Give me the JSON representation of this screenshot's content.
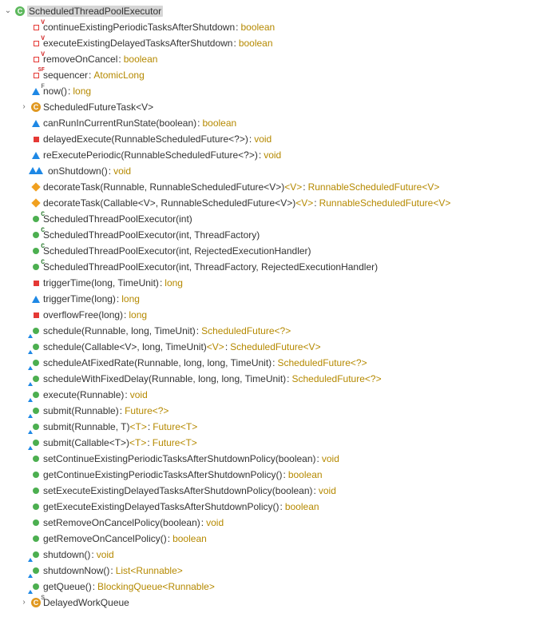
{
  "root": {
    "twisty": "open",
    "iconOverlays": [
      "VolatileRed"
    ],
    "name": "ScheduledThreadPoolExecutor",
    "selected": true
  },
  "members": [
    {
      "twisty": "none",
      "icon": "field-private",
      "ov1": {
        "txt": "V",
        "cls": "red"
      },
      "name": "continueExistingPeriodicTasksAfterShutdown",
      "ret": "boolean"
    },
    {
      "twisty": "none",
      "icon": "field-private",
      "ov1": {
        "txt": "V",
        "cls": "red"
      },
      "name": "executeExistingDelayedTasksAfterShutdown",
      "ret": "boolean"
    },
    {
      "twisty": "none",
      "icon": "field-private",
      "ov1": {
        "txt": "V",
        "cls": "red"
      },
      "name": "removeOnCancel",
      "ret": "boolean"
    },
    {
      "twisty": "none",
      "icon": "field-private",
      "ov1": {
        "txt": "SF",
        "cls": "red",
        "small": true
      },
      "name": "sequencer",
      "ret": "AtomicLong"
    },
    {
      "twisty": "none",
      "icon": "default",
      "ov1": {
        "txt": "F",
        "cls": "grey"
      },
      "name": "now()",
      "ret": "long"
    },
    {
      "twisty": "closed",
      "icon": "class-private",
      "name": "ScheduledFutureTask<V>"
    },
    {
      "twisty": "none",
      "icon": "default",
      "name": "canRunInCurrentRunState(boolean)",
      "ret": "boolean"
    },
    {
      "twisty": "none",
      "icon": "method-private",
      "name": "delayedExecute(RunnableScheduledFuture<?>)",
      "ret": "void"
    },
    {
      "twisty": "none",
      "icon": "default",
      "name": "reExecutePeriodic(RunnableScheduledFuture<?>)",
      "ret": "void"
    },
    {
      "twisty": "none",
      "icon": "dual-default",
      "name": "onShutdown()",
      "ret": "void"
    },
    {
      "twisty": "none",
      "icon": "protected",
      "name": "decorateTask(Runnable, RunnableScheduledFuture<V>)",
      "generic": "<V>",
      "ret": "RunnableScheduledFuture<V>"
    },
    {
      "twisty": "none",
      "icon": "protected",
      "name": "decorateTask(Callable<V>, RunnableScheduledFuture<V>)",
      "generic": "<V>",
      "ret": "RunnableScheduledFuture<V>"
    },
    {
      "twisty": "none",
      "icon": "method-public",
      "ov1": {
        "txt": "C",
        "cls": "green"
      },
      "name": "ScheduledThreadPoolExecutor(int)"
    },
    {
      "twisty": "none",
      "icon": "method-public",
      "ov1": {
        "txt": "C",
        "cls": "green"
      },
      "name": "ScheduledThreadPoolExecutor(int, ThreadFactory)"
    },
    {
      "twisty": "none",
      "icon": "method-public",
      "ov1": {
        "txt": "C",
        "cls": "green"
      },
      "name": "ScheduledThreadPoolExecutor(int, RejectedExecutionHandler)"
    },
    {
      "twisty": "none",
      "icon": "method-public",
      "ov1": {
        "txt": "C",
        "cls": "green"
      },
      "name": "ScheduledThreadPoolExecutor(int, ThreadFactory, RejectedExecutionHandler)"
    },
    {
      "twisty": "none",
      "icon": "method-private",
      "name": "triggerTime(long, TimeUnit)",
      "ret": "long"
    },
    {
      "twisty": "none",
      "icon": "default",
      "name": "triggerTime(long)",
      "ret": "long"
    },
    {
      "twisty": "none",
      "icon": "method-private",
      "name": "overflowFree(long)",
      "ret": "long"
    },
    {
      "twisty": "none",
      "icon": "method-public",
      "ovTri": true,
      "name": "schedule(Runnable, long, TimeUnit)",
      "ret": "ScheduledFuture<?>"
    },
    {
      "twisty": "none",
      "icon": "method-public",
      "ovTri": true,
      "name": "schedule(Callable<V>, long, TimeUnit)",
      "generic": "<V>",
      "ret": "ScheduledFuture<V>"
    },
    {
      "twisty": "none",
      "icon": "method-public",
      "ovTri": true,
      "name": "scheduleAtFixedRate(Runnable, long, long, TimeUnit)",
      "ret": "ScheduledFuture<?>"
    },
    {
      "twisty": "none",
      "icon": "method-public",
      "ovTri": true,
      "name": "scheduleWithFixedDelay(Runnable, long, long, TimeUnit)",
      "ret": "ScheduledFuture<?>"
    },
    {
      "twisty": "none",
      "icon": "method-public",
      "ovTri": true,
      "name": "execute(Runnable)",
      "ret": "void"
    },
    {
      "twisty": "none",
      "icon": "method-public",
      "ovTri": true,
      "name": "submit(Runnable)",
      "ret": "Future<?>"
    },
    {
      "twisty": "none",
      "icon": "method-public",
      "ovTri": true,
      "name": "submit(Runnable, T)",
      "generic": "<T>",
      "ret": "Future<T>"
    },
    {
      "twisty": "none",
      "icon": "method-public",
      "ovTri": true,
      "name": "submit(Callable<T>)",
      "generic": "<T>",
      "ret": "Future<T>"
    },
    {
      "twisty": "none",
      "icon": "method-public",
      "name": "setContinueExistingPeriodicTasksAfterShutdownPolicy(boolean)",
      "ret": "void"
    },
    {
      "twisty": "none",
      "icon": "method-public",
      "name": "getContinueExistingPeriodicTasksAfterShutdownPolicy()",
      "ret": "boolean"
    },
    {
      "twisty": "none",
      "icon": "method-public",
      "name": "setExecuteExistingDelayedTasksAfterShutdownPolicy(boolean)",
      "ret": "void"
    },
    {
      "twisty": "none",
      "icon": "method-public",
      "name": "getExecuteExistingDelayedTasksAfterShutdownPolicy()",
      "ret": "boolean"
    },
    {
      "twisty": "none",
      "icon": "method-public",
      "name": "setRemoveOnCancelPolicy(boolean)",
      "ret": "void"
    },
    {
      "twisty": "none",
      "icon": "method-public",
      "name": "getRemoveOnCancelPolicy()",
      "ret": "boolean"
    },
    {
      "twisty": "none",
      "icon": "method-public",
      "ovTri": true,
      "name": "shutdown()",
      "ret": "void"
    },
    {
      "twisty": "none",
      "icon": "method-public",
      "ovTri": true,
      "name": "shutdownNow()",
      "ret": "List<Runnable>"
    },
    {
      "twisty": "none",
      "icon": "method-public",
      "ovTri": true,
      "name": "getQueue()",
      "ret": "BlockingQueue<Runnable>"
    },
    {
      "twisty": "closed",
      "icon": "class-private",
      "ov1": {
        "txt": "S",
        "cls": "grey"
      },
      "name": "DelayedWorkQueue"
    }
  ],
  "twistyOpenGlyph": "⌄",
  "twistyClosedGlyph": "›"
}
